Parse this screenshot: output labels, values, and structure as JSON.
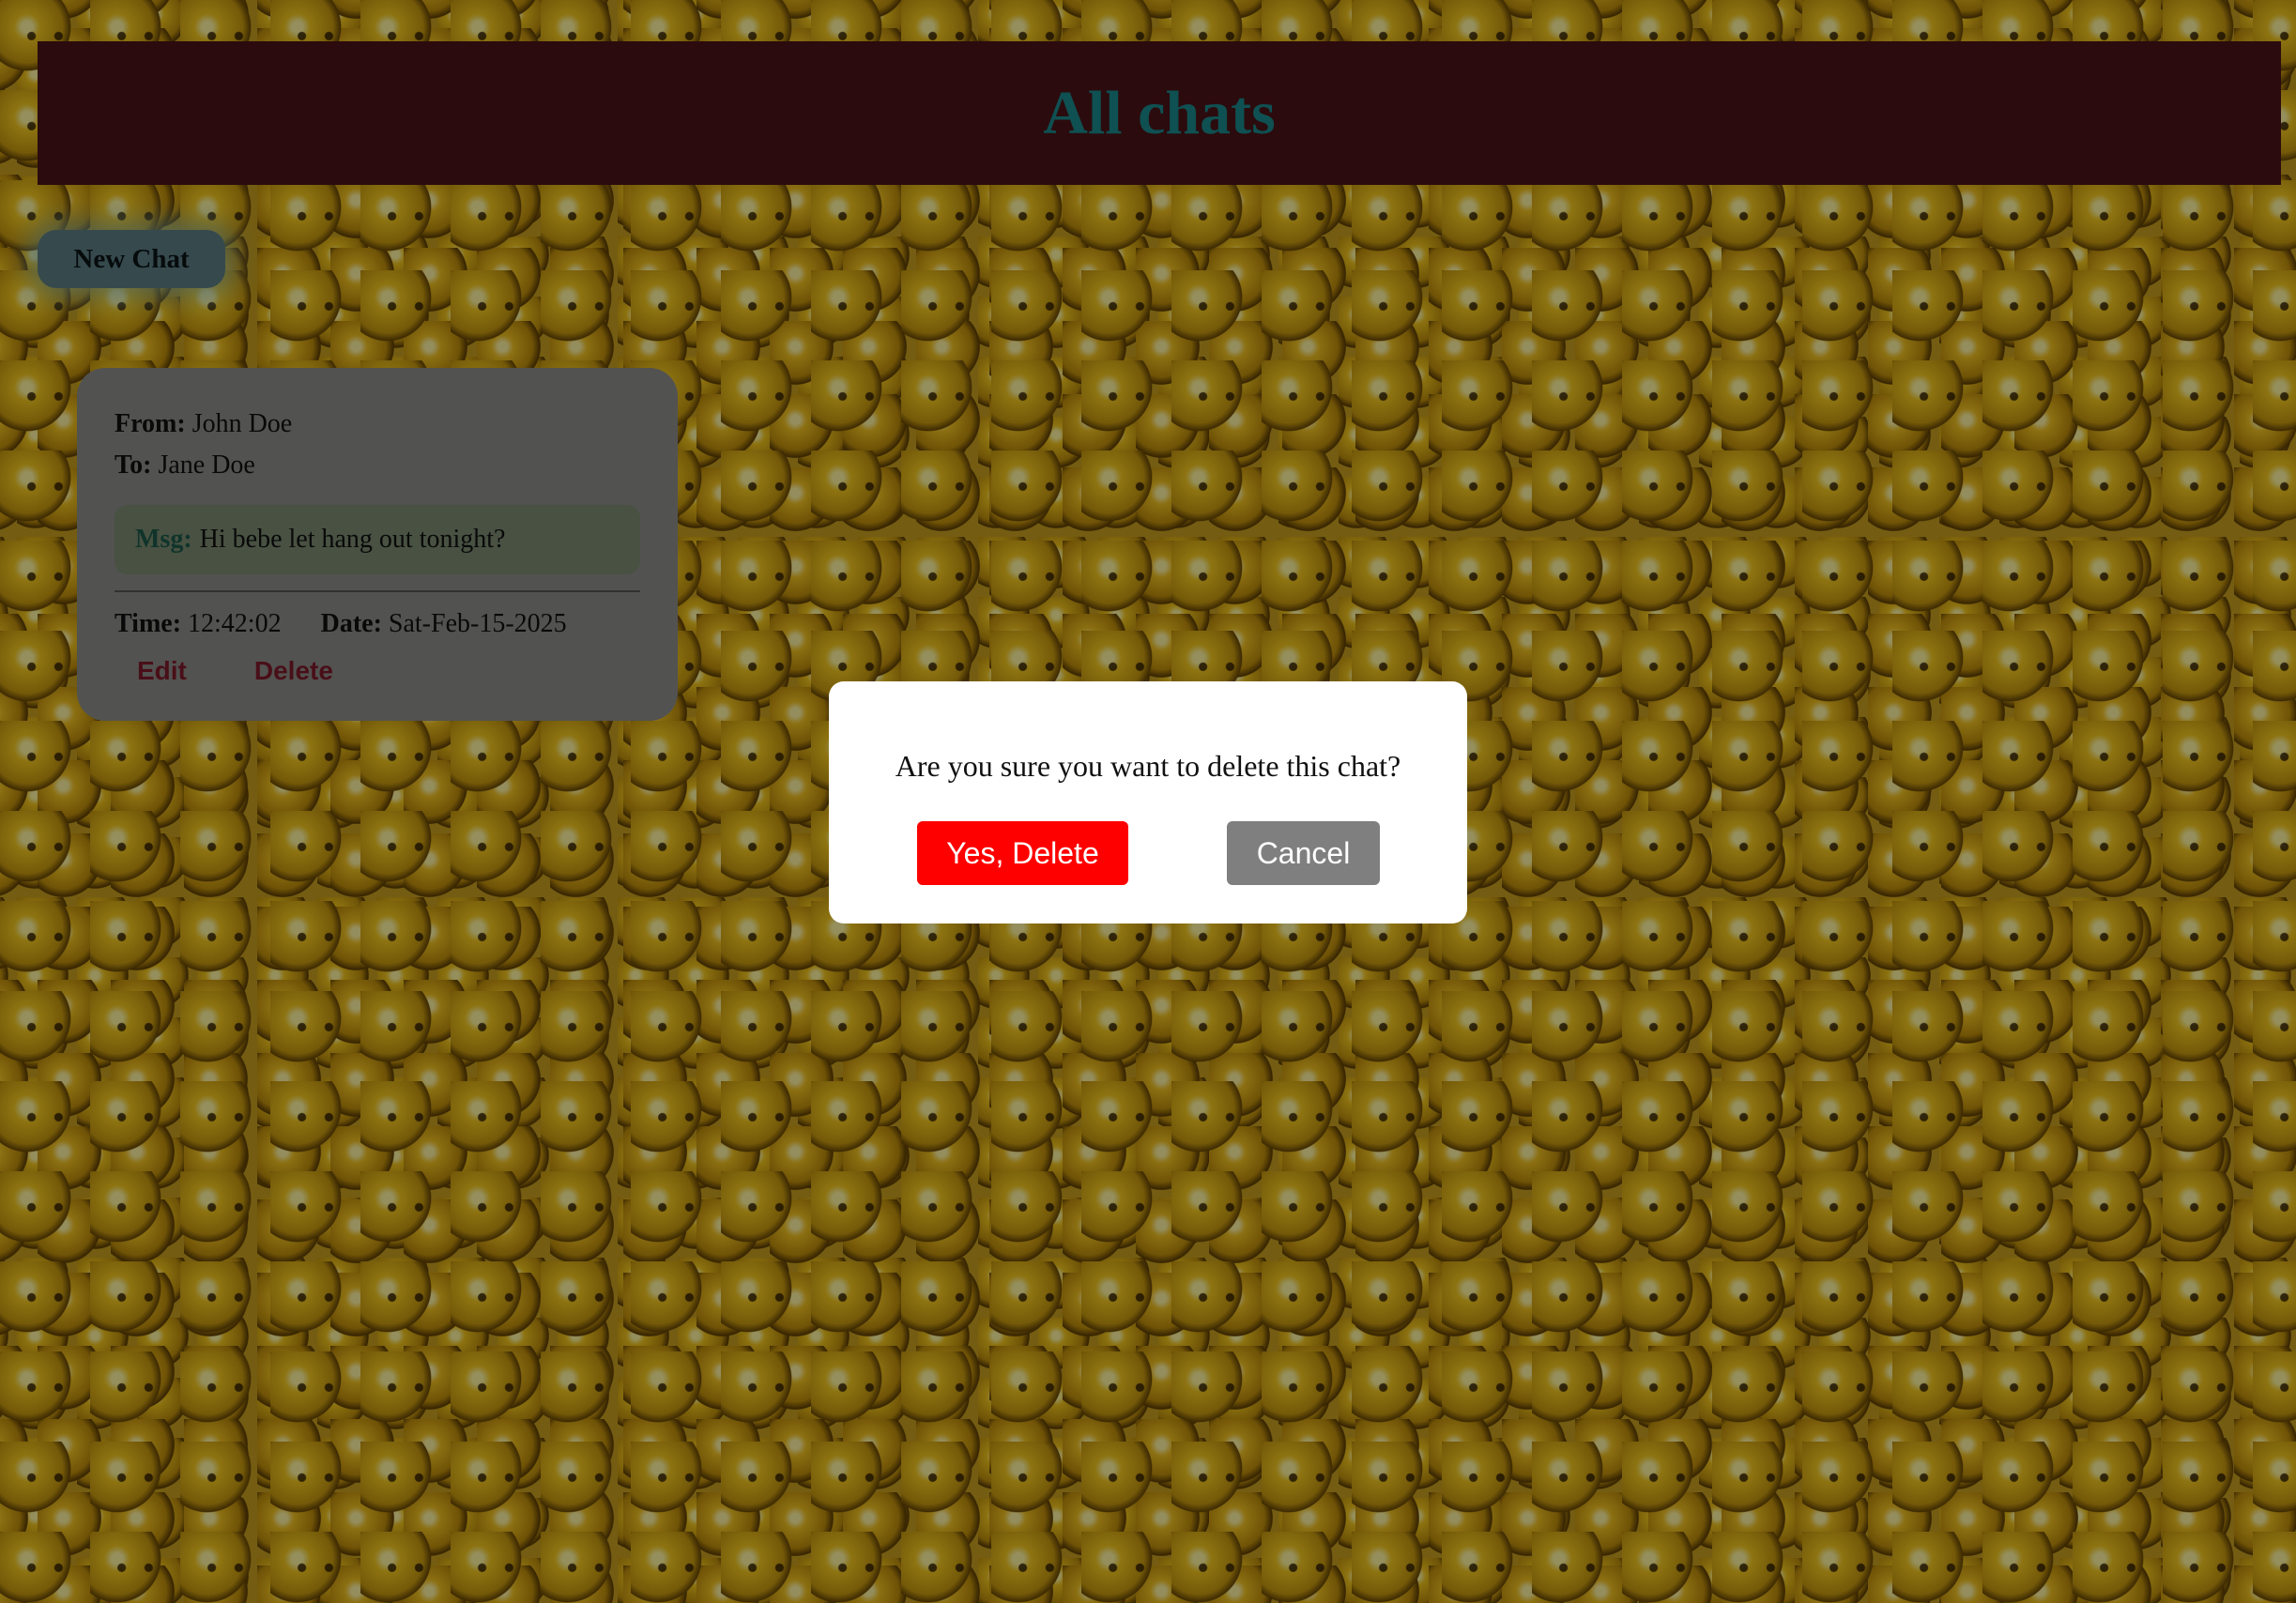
{
  "header": {
    "title": "All chats"
  },
  "toolbar": {
    "new_chat_label": "New Chat"
  },
  "chats": [
    {
      "from_label": "From:",
      "from": "John Doe",
      "to_label": "To:",
      "to": "Jane Doe",
      "msg_label": "Msg:",
      "msg": "Hi bebe let hang out tonight?",
      "time_label": "Time:",
      "time": "12:42:02",
      "date_label": "Date:",
      "date": "Sat-Feb-15-2025",
      "edit_label": "Edit",
      "delete_label": "Delete"
    }
  ],
  "modal": {
    "message": "Are you sure you want to delete this chat?",
    "confirm_label": "Yes, Delete",
    "cancel_label": "Cancel"
  },
  "colors": {
    "header_bg": "#4b1418",
    "title": "#1a8a8e",
    "danger": "#ff0000",
    "cancel": "#7f7f7f",
    "link": "#7e1a2a"
  },
  "background": {
    "pattern": "emoji-faces"
  }
}
